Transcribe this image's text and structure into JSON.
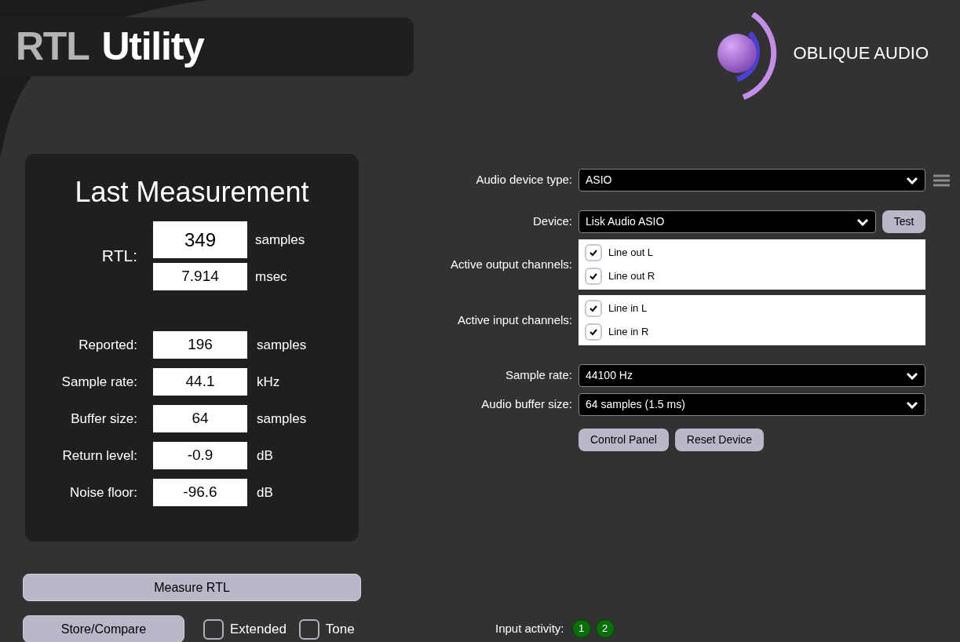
{
  "app_title": [
    {
      "text": "RTL",
      "kind": "dim"
    },
    {
      "text": "Utility",
      "kind": "bright"
    }
  ],
  "brand": "OBLIQUE AUDIO",
  "measurement": {
    "title": "Last Measurement",
    "rtl_label": "RTL:",
    "rtl_values": [
      {
        "value": "349",
        "unit": "samples"
      },
      {
        "value": "7.914",
        "unit": "msec"
      }
    ],
    "rows": [
      {
        "label": "Reported:",
        "value": "196",
        "unit": "samples"
      },
      {
        "label": "Sample rate:",
        "value": "44.1",
        "unit": "kHz"
      },
      {
        "label": "Buffer size:",
        "value": "64",
        "unit": "samples"
      },
      {
        "label": "Return level:",
        "value": "-0.9",
        "unit": "dB"
      },
      {
        "label": "Noise floor:",
        "value": "-96.6",
        "unit": "dB"
      }
    ]
  },
  "measure_button": "Measure RTL",
  "store_button": "Store/Compare",
  "options": [
    {
      "label": "Extended",
      "checked": false
    },
    {
      "label": "Tone",
      "checked": false
    }
  ],
  "device_type": {
    "label": "Audio device type:",
    "value": "ASIO"
  },
  "device": {
    "label": "Device:",
    "value": "Lisk Audio ASIO",
    "button": "Test"
  },
  "output_channels": {
    "label": "Active output channels:",
    "items": [
      {
        "label": "Line out L",
        "checked": true
      },
      {
        "label": "Line out R",
        "checked": true
      }
    ]
  },
  "input_channels": {
    "label": "Active input channels:",
    "items": [
      {
        "label": "Line in L",
        "checked": true
      },
      {
        "label": "Line in R",
        "checked": true
      }
    ]
  },
  "sample_rate": {
    "label": "Sample rate:",
    "value": "44100 Hz"
  },
  "buffer_size": {
    "label": "Audio buffer size:",
    "value": "64 samples (1.5 ms)"
  },
  "device_buttons": [
    "Control Panel",
    "Reset Device"
  ],
  "input_activity": {
    "label": "Input activity:",
    "channels": [
      {
        "label": "1",
        "active": true
      },
      {
        "label": "2",
        "active": true
      }
    ]
  }
}
